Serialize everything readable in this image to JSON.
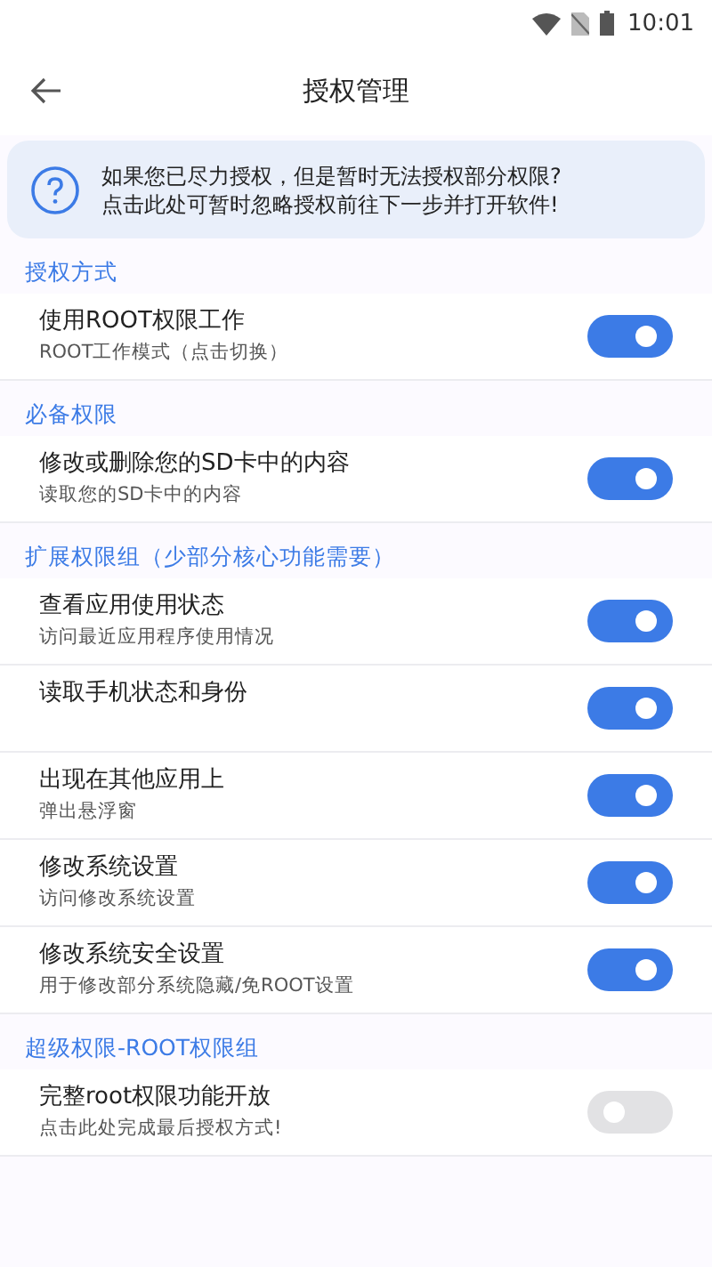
{
  "status_bar": {
    "time": "10:01"
  },
  "toolbar": {
    "title": "授权管理"
  },
  "notice": {
    "text": "如果您已尽力授权，但是暂时无法授权部分权限?\n点击此处可暂时忽略授权前往下一步并打开软件!"
  },
  "sections": [
    {
      "title": "授权方式",
      "items": [
        {
          "title": "使用ROOT权限工作",
          "subtitle": "ROOT工作模式（点击切换）",
          "on": true
        }
      ]
    },
    {
      "title": "必备权限",
      "items": [
        {
          "title": "修改或删除您的SD卡中的内容",
          "subtitle": "读取您的SD卡中的内容",
          "on": true
        }
      ]
    },
    {
      "title": "扩展权限组（少部分核心功能需要）",
      "items": [
        {
          "title": "查看应用使用状态",
          "subtitle": "访问最近应用程序使用情况",
          "on": true
        },
        {
          "title": "读取手机状态和身份",
          "on": true
        },
        {
          "title": "出现在其他应用上",
          "subtitle": "弹出悬浮窗",
          "on": true
        },
        {
          "title": "修改系统设置",
          "subtitle": "访问修改系统设置",
          "on": true
        },
        {
          "title": "修改系统安全设置",
          "subtitle": "用于修改部分系统隐藏/免ROOT设置",
          "on": true
        }
      ]
    },
    {
      "title": "超级权限-ROOT权限组",
      "items": [
        {
          "title": "完整root权限功能开放",
          "subtitle": "点击此处完成最后授权方式!",
          "on": false
        }
      ]
    }
  ]
}
